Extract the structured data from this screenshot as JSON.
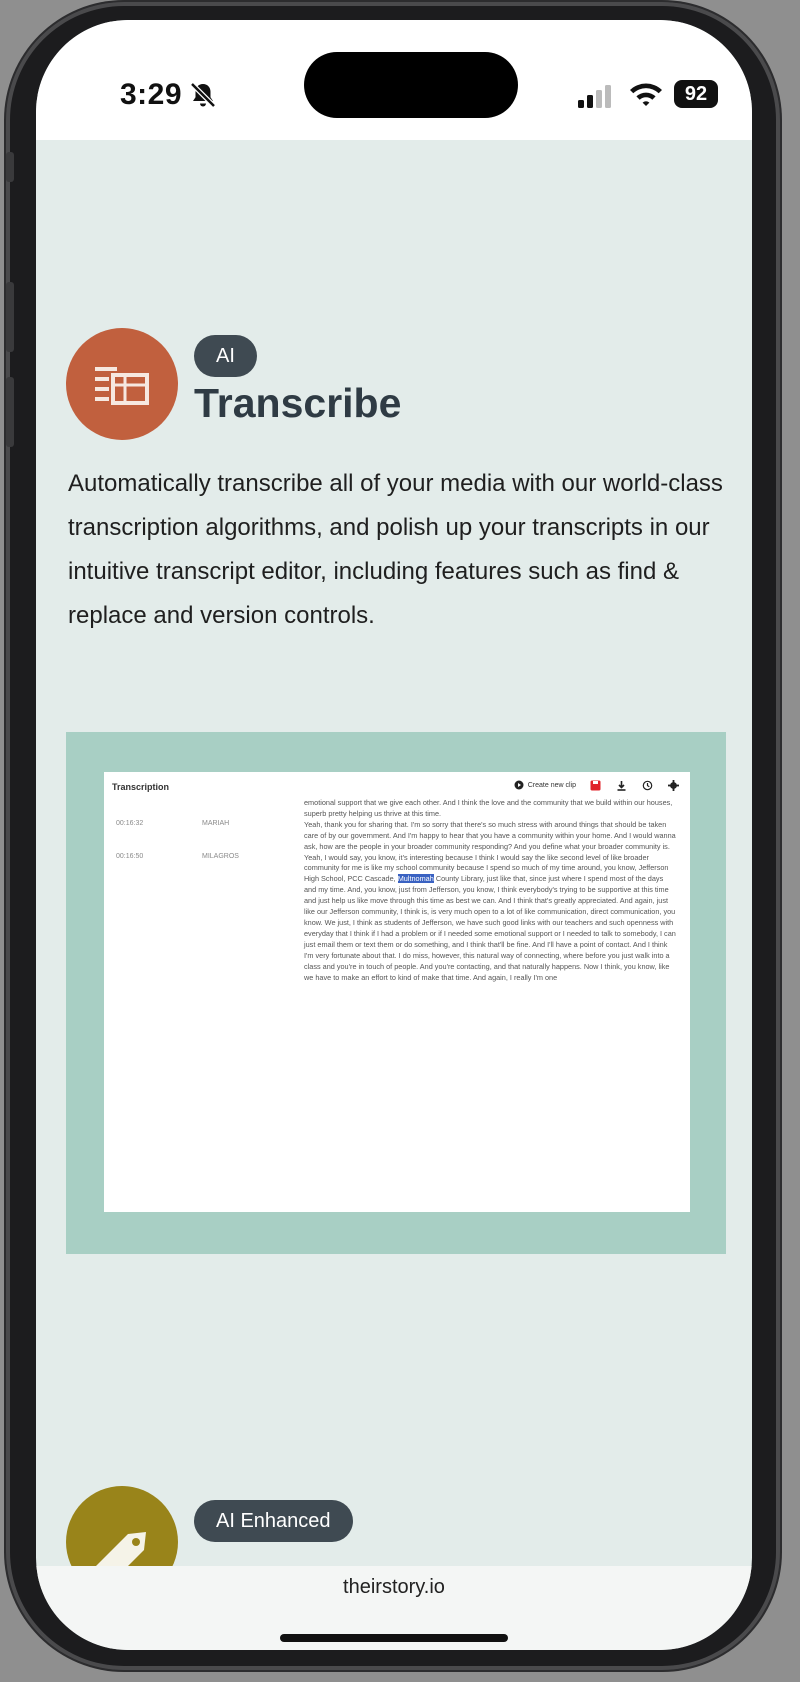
{
  "status_bar": {
    "time": "3:29",
    "battery": "92"
  },
  "feature": {
    "badge": "AI",
    "title": "Transcribe",
    "description": "Automatically transcribe all of your media with our world-class transcription algorithms, and polish up your transcripts in our intuitive transcript editor, including features such as find & replace and version controls.",
    "icon": "transcript-icon",
    "icon_color": "#c1603e"
  },
  "screenshot": {
    "title": "Transcription",
    "clip_button": "Create new clip",
    "rows": [
      {
        "timestamp": "",
        "speaker": "",
        "text": "emotional support that we give each other. And I think the love and the community that we build within our houses, superb pretty helping us thrive at this time."
      },
      {
        "timestamp": "00:16:32",
        "speaker": "MARIAH",
        "text": "Yeah, thank you for sharing that. I'm so sorry that there's so much stress with around things that should be taken care of by our government. And I'm happy to hear that you have a community within your home. And I would wanna ask, how are the people in your broader community responding? And you define what your broader community is."
      },
      {
        "timestamp": "00:16:50",
        "speaker": "MILAGROS",
        "text_before": "Yeah, I would say, you know, it's interesting because I think I would say the like second level of like broader community for me is like my school community because I spend so much of my time around, you know, Jefferson High School, PCC Cascade, ",
        "highlight": "Multnomah",
        "text_after": " County Library, just like that, since just where I spend most of the days and my time. And, you know, just from Jefferson, you know, I think everybody's trying to be supportive at this time and just help us like move through this time as best we can. And I think that's greatly appreciated. And again, just like our Jefferson community, I think is, is very much open to a lot of like communication, direct communication, you know. We just, I think as students of Jefferson, we have such good links with our teachers and such openness with everyday that I think if I had a problem or if I needed some emotional support or I needed to talk to somebody, I can just email them or text them or do something, and I think that'll be fine. And I'll have a point of contact. And I think I'm very fortunate about that. I do miss, however, this natural way of connecting, where before you just walk into a class and you're in touch of people. And you're contacting, and that naturally happens. Now I think, you know, like we have to make an effort to kind of make that time. And again, I really I'm one"
      }
    ]
  },
  "next_feature": {
    "badge": "AI Enhanced",
    "icon_color": "#99841a"
  },
  "browser": {
    "url": "theirstory.io"
  }
}
